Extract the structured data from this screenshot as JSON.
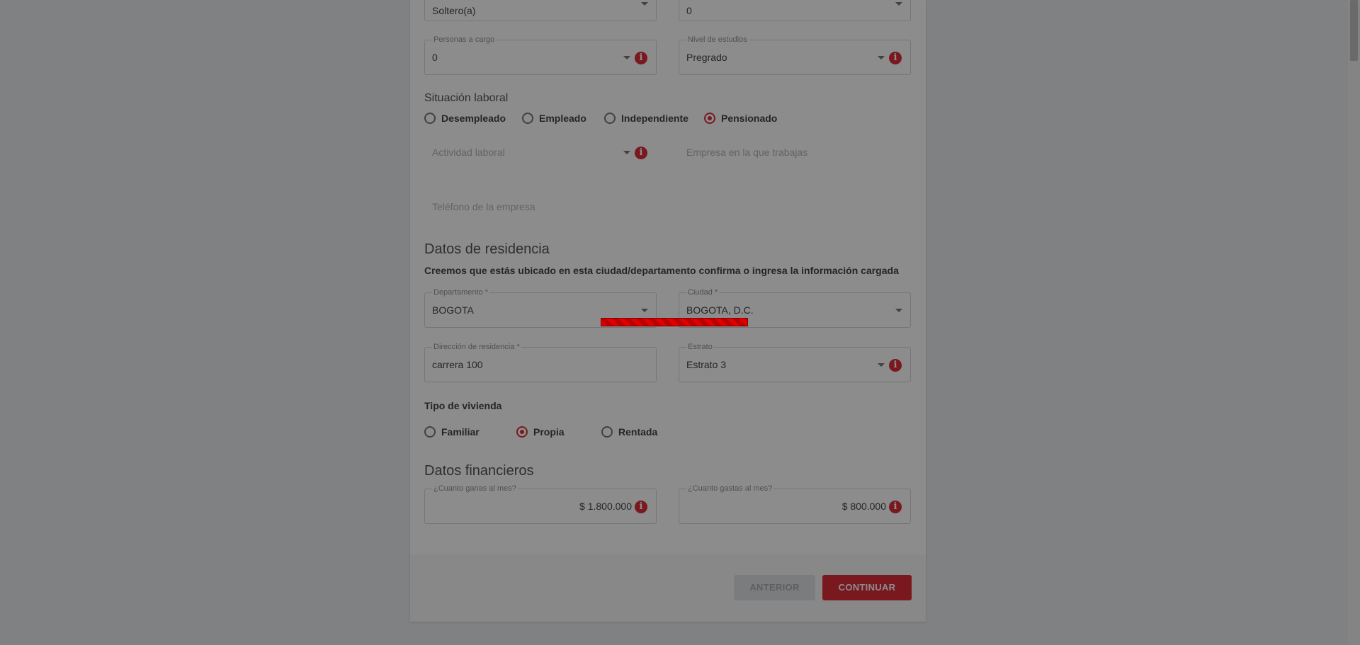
{
  "personal": {
    "estado_civil": {
      "value": "Soltero(a)"
    },
    "hijos": {
      "value": "0"
    },
    "personas_a_cargo": {
      "label": "Personas a cargo",
      "value": "0"
    },
    "nivel_estudios": {
      "label": "Nivel de estudios",
      "value": "Pregrado"
    }
  },
  "laboral": {
    "title": "Situación laboral",
    "options": [
      "Desempleado",
      "Empleado",
      "Independiente",
      "Pensionado"
    ],
    "selected": "Pensionado",
    "actividad_placeholder": "Actividad laboral",
    "empresa_placeholder": "Empresa en la que trabajas",
    "telefono_placeholder": "Teléfono de la empresa"
  },
  "residencia": {
    "title": "Datos de residencia",
    "subtitle": "Creemos que estás ubicado en esta ciudad/departamento confirma o ingresa la información cargada",
    "departamento": {
      "label": "Departamento *",
      "value": "BOGOTA"
    },
    "ciudad": {
      "label": "Ciudad *",
      "value": "BOGOTA, D.C."
    },
    "direccion": {
      "label": "Dirección de residencia *",
      "value": "carrera 100"
    },
    "estrato": {
      "label": "Estrato",
      "value": "Estrato 3"
    },
    "vivienda_title": "Tipo de vivienda",
    "vivienda_options": [
      "Familiar",
      "Propia",
      "Rentada"
    ],
    "vivienda_selected": "Propia"
  },
  "financieros": {
    "title": "Datos financieros",
    "ingresos": {
      "label": "¿Cuanto ganas al mes?",
      "value": "$ 1.800.000"
    },
    "gastos": {
      "label": "¿Cuanto gastas al mes?",
      "value": "$ 800.000"
    }
  },
  "buttons": {
    "anterior": "ANTERIOR",
    "continuar": "CONTINUAR"
  },
  "loading": {
    "visible": true
  },
  "colors": {
    "accent": "#dc2f3a",
    "overlay": "rgba(0,0,0,0.45)",
    "progress": "#e10000"
  },
  "icons": {
    "info": "info-icon",
    "dropdown": "chevron-down-icon"
  }
}
